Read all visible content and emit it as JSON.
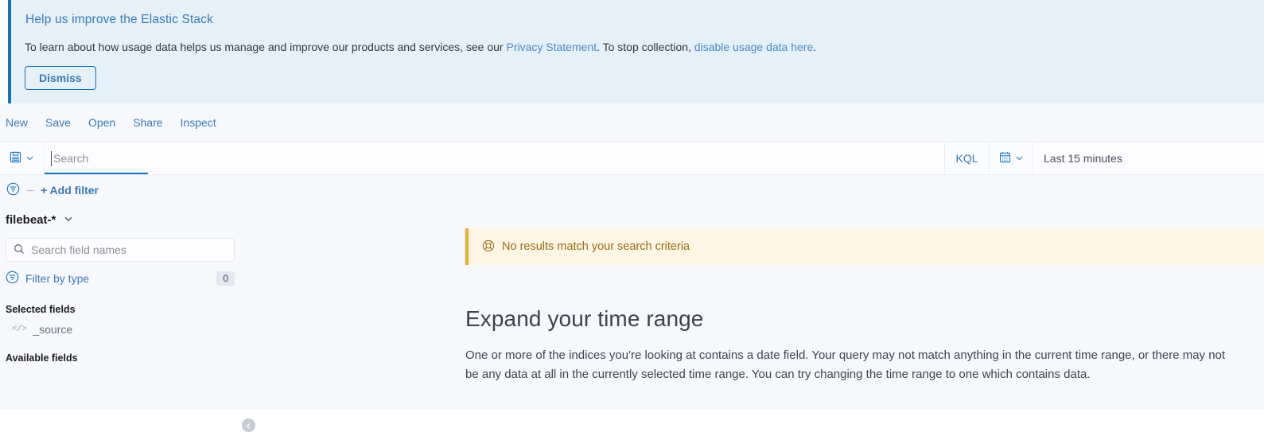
{
  "banner": {
    "title": "Help us improve the Elastic Stack",
    "body_part1": "To learn about how usage data helps us manage and improve our products and services, see our ",
    "privacy_link": "Privacy Statement",
    "body_part2": ". To stop collection, ",
    "disable_link": "disable usage data here",
    "body_part3": ".",
    "dismiss_label": "Dismiss",
    "accent_color": "#1273be",
    "background_color": "#e6f0f8"
  },
  "topnav": {
    "items": [
      {
        "label": "New",
        "name": "new"
      },
      {
        "label": "Save",
        "name": "save"
      },
      {
        "label": "Open",
        "name": "open"
      },
      {
        "label": "Share",
        "name": "share"
      },
      {
        "label": "Inspect",
        "name": "inspect"
      }
    ]
  },
  "querybar": {
    "saved_query_icon": "floppy-disk-icon",
    "saved_query_chevron": "chevron-down-icon",
    "search_placeholder": "Search",
    "search_value": "",
    "language": "KQL",
    "date_icon": "calendar-icon",
    "date_chevron": "chevron-down-icon",
    "date_range": "Last 15 minutes"
  },
  "filterbar": {
    "filter_icon": "filter-icon",
    "add_filter_label": "+ Add filter"
  },
  "sidebar": {
    "index_pattern": "filebeat-*",
    "index_chevron": "chevron-down-icon",
    "collapse_icon": "chevron-left-icon",
    "field_search_placeholder": "Search field names",
    "field_search_value": "",
    "search_icon": "search-icon",
    "filter_by_type_label": "Filter by type",
    "filter_by_type_icon": "filter-icon",
    "filter_by_type_count": "0",
    "selected_fields_title": "Selected fields",
    "selected_fields": [
      {
        "name": "_source",
        "type_icon": "source-code-icon"
      }
    ],
    "available_fields_title": "Available fields"
  },
  "content": {
    "warning_icon": "lifebuoy-icon",
    "warning_text": "No results match your search criteria",
    "warning_color": "#9b6d12",
    "warning_background": "#fdf6e7",
    "warning_accent": "#f0ab2e",
    "empty_title": "Expand your time range",
    "empty_body": "One or more of the indices you're looking at contains a date field. Your query may not match anything in the current time range, or there may not be any data at all in the currently selected time range. You can try changing the time range to one which contains data."
  }
}
